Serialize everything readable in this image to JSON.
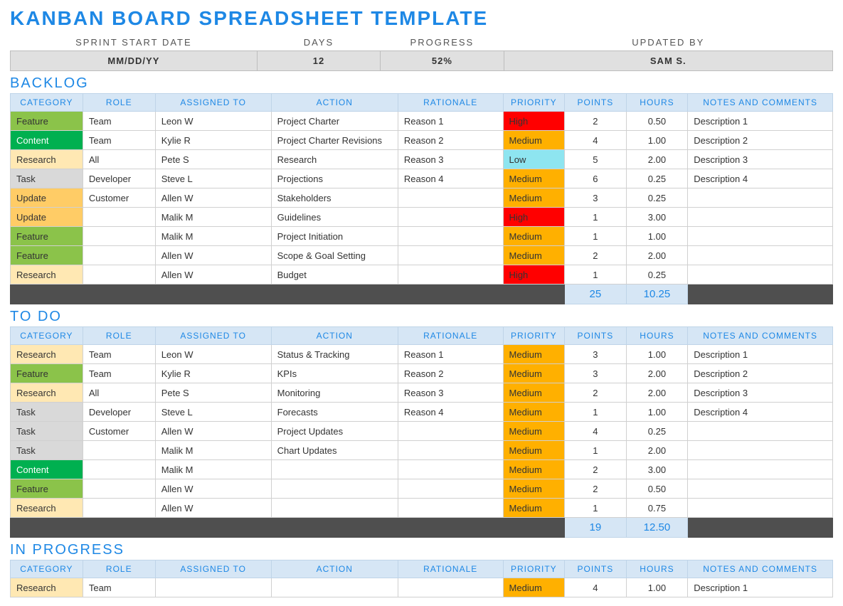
{
  "title": "KANBAN BOARD SPREADSHEET TEMPLATE",
  "meta": {
    "headers": [
      "SPRINT START DATE",
      "DAYS",
      "PROGRESS",
      "UPDATED BY"
    ],
    "values": [
      "MM/DD/YY",
      "12",
      "52%",
      "SAM S."
    ]
  },
  "columns": [
    "CATEGORY",
    "ROLE",
    "ASSIGNED TO",
    "ACTION",
    "RATIONALE",
    "PRIORITY",
    "POINTS",
    "HOURS",
    "NOTES AND COMMENTS"
  ],
  "colors": {
    "category": {
      "Feature": "#8BC34A",
      "Content": "#00B050",
      "Research": "#FFE8B3",
      "Task": "#D9D9D9",
      "Update": "#FFCC66"
    },
    "priority": {
      "High": "#FF0000",
      "Medium": "#FFB000",
      "Low": "#8EE5F0"
    },
    "categoryText": "#333",
    "categoryTextDark": {
      "Content": "#fff"
    }
  },
  "sections": [
    {
      "name": "BACKLOG",
      "rows": [
        {
          "category": "Feature",
          "role": "Team",
          "assigned": "Leon W",
          "action": "Project Charter",
          "rationale": "Reason 1",
          "priority": "High",
          "points": "2",
          "hours": "0.50",
          "notes": "Description 1"
        },
        {
          "category": "Content",
          "role": "Team",
          "assigned": "Kylie R",
          "action": "Project Charter Revisions",
          "rationale": "Reason 2",
          "priority": "Medium",
          "points": "4",
          "hours": "1.00",
          "notes": "Description 2"
        },
        {
          "category": "Research",
          "role": "All",
          "assigned": "Pete S",
          "action": "Research",
          "rationale": "Reason 3",
          "priority": "Low",
          "points": "5",
          "hours": "2.00",
          "notes": "Description 3"
        },
        {
          "category": "Task",
          "role": "Developer",
          "assigned": "Steve L",
          "action": "Projections",
          "rationale": "Reason 4",
          "priority": "Medium",
          "points": "6",
          "hours": "0.25",
          "notes": "Description 4"
        },
        {
          "category": "Update",
          "role": "Customer",
          "assigned": "Allen W",
          "action": "Stakeholders",
          "rationale": "",
          "priority": "Medium",
          "points": "3",
          "hours": "0.25",
          "notes": ""
        },
        {
          "category": "Update",
          "role": "",
          "assigned": "Malik M",
          "action": "Guidelines",
          "rationale": "",
          "priority": "High",
          "points": "1",
          "hours": "3.00",
          "notes": ""
        },
        {
          "category": "Feature",
          "role": "",
          "assigned": "Malik M",
          "action": "Project Initiation",
          "rationale": "",
          "priority": "Medium",
          "points": "1",
          "hours": "1.00",
          "notes": ""
        },
        {
          "category": "Feature",
          "role": "",
          "assigned": "Allen W",
          "action": "Scope & Goal Setting",
          "rationale": "",
          "priority": "Medium",
          "points": "2",
          "hours": "2.00",
          "notes": ""
        },
        {
          "category": "Research",
          "role": "",
          "assigned": "Allen W",
          "action": "Budget",
          "rationale": "",
          "priority": "High",
          "points": "1",
          "hours": "0.25",
          "notes": ""
        }
      ],
      "totals": {
        "points": "25",
        "hours": "10.25"
      }
    },
    {
      "name": "TO DO",
      "rows": [
        {
          "category": "Research",
          "role": "Team",
          "assigned": "Leon W",
          "action": "Status & Tracking",
          "rationale": "Reason 1",
          "priority": "Medium",
          "points": "3",
          "hours": "1.00",
          "notes": "Description 1"
        },
        {
          "category": "Feature",
          "role": "Team",
          "assigned": "Kylie R",
          "action": "KPIs",
          "rationale": "Reason 2",
          "priority": "Medium",
          "points": "3",
          "hours": "2.00",
          "notes": "Description 2"
        },
        {
          "category": "Research",
          "role": "All",
          "assigned": "Pete S",
          "action": "Monitoring",
          "rationale": "Reason 3",
          "priority": "Medium",
          "points": "2",
          "hours": "2.00",
          "notes": "Description 3"
        },
        {
          "category": "Task",
          "role": "Developer",
          "assigned": "Steve L",
          "action": "Forecasts",
          "rationale": "Reason 4",
          "priority": "Medium",
          "points": "1",
          "hours": "1.00",
          "notes": "Description 4"
        },
        {
          "category": "Task",
          "role": "Customer",
          "assigned": "Allen W",
          "action": "Project Updates",
          "rationale": "",
          "priority": "Medium",
          "points": "4",
          "hours": "0.25",
          "notes": ""
        },
        {
          "category": "Task",
          "role": "",
          "assigned": "Malik M",
          "action": "Chart Updates",
          "rationale": "",
          "priority": "Medium",
          "points": "1",
          "hours": "2.00",
          "notes": ""
        },
        {
          "category": "Content",
          "role": "",
          "assigned": "Malik M",
          "action": "",
          "rationale": "",
          "priority": "Medium",
          "points": "2",
          "hours": "3.00",
          "notes": ""
        },
        {
          "category": "Feature",
          "role": "",
          "assigned": "Allen W",
          "action": "",
          "rationale": "",
          "priority": "Medium",
          "points": "2",
          "hours": "0.50",
          "notes": ""
        },
        {
          "category": "Research",
          "role": "",
          "assigned": "Allen W",
          "action": "",
          "rationale": "",
          "priority": "Medium",
          "points": "1",
          "hours": "0.75",
          "notes": ""
        }
      ],
      "totals": {
        "points": "19",
        "hours": "12.50"
      }
    },
    {
      "name": "IN PROGRESS",
      "rows": [
        {
          "category": "Research",
          "role": "Team",
          "assigned": "",
          "action": "",
          "rationale": "",
          "priority": "Medium",
          "points": "4",
          "hours": "1.00",
          "notes": "Description 1"
        }
      ]
    }
  ]
}
